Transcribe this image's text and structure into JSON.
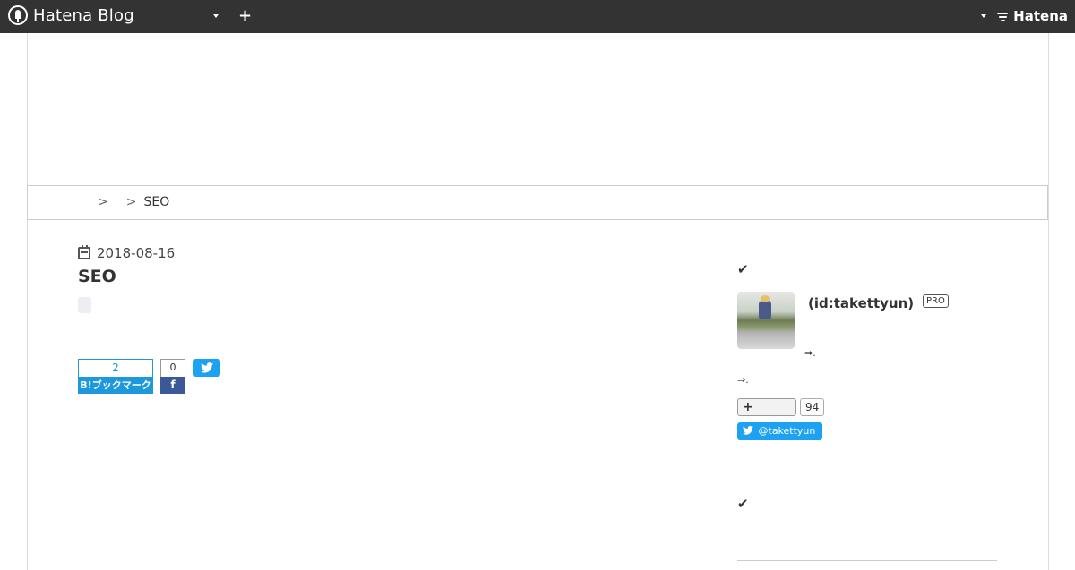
{
  "topbar": {
    "brand": "Hatena Blog",
    "add_icon": "+",
    "hatena_label": "Hatena"
  },
  "breadcrumb": {
    "sep1": ">",
    "sep2": ">",
    "current": "SEO"
  },
  "article": {
    "date": "2018-08-16",
    "title": "SEO"
  },
  "share": {
    "hatena_count": "2",
    "hatena_label": "B!ブックマーク",
    "facebook_count": "0",
    "facebook_icon": "f",
    "twitter_icon": "🐦"
  },
  "sidebar": {
    "check1": "✔",
    "profile_name": "(id:takettyun)",
    "pro_badge": "PRO",
    "link1": "⇒.",
    "link2": "⇒.",
    "follow_icon": "+",
    "follow_count": "94",
    "twitter_follow": "@takettyun",
    "check2": "✔"
  },
  "icons": {
    "brand_logo": "hatena-blog-logo-icon",
    "calendar": "calendar-icon",
    "check": "check-icon",
    "twitter": "twitter-icon",
    "facebook": "facebook-icon"
  },
  "colors": {
    "topbar_bg": "#333333",
    "hatena_blue": "#1e98dc",
    "facebook_blue": "#3b5998",
    "twitter_blue": "#1da1f2"
  }
}
